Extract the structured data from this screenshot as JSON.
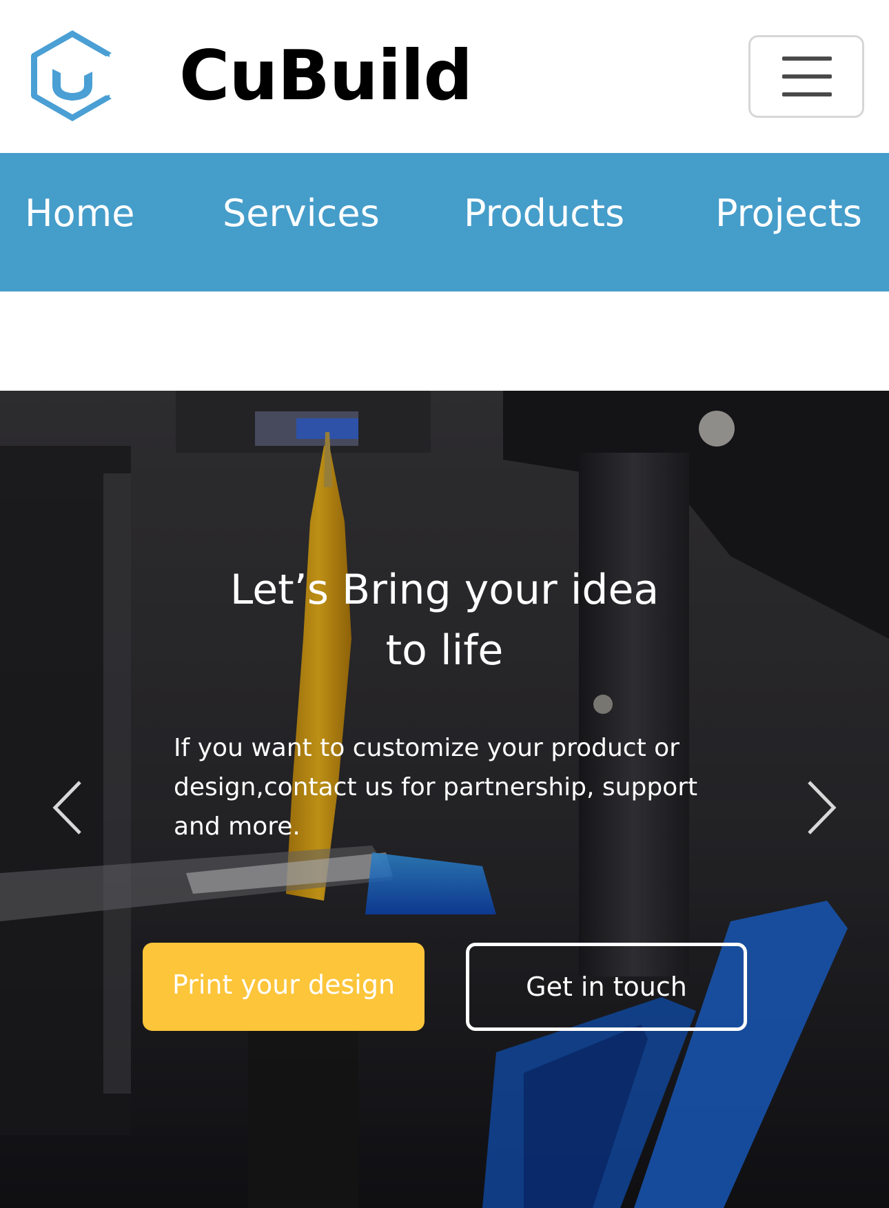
{
  "header": {
    "brand": "CuBuild",
    "logo_icon": "hexagon-cube-logo-icon",
    "menu_icon": "hamburger-menu-icon"
  },
  "nav": {
    "items": [
      {
        "label": "Home"
      },
      {
        "label": "Services"
      },
      {
        "label": "Products"
      },
      {
        "label": "Projects"
      }
    ]
  },
  "hero": {
    "title_line1": "Let’s Bring your idea",
    "title_line2": "to life",
    "text": "If you want to customize your product or design,contact us for partnership, support and more.",
    "primary_button": "Print your design",
    "secondary_button": "Get in touch",
    "prev_icon": "chevron-left-icon",
    "next_icon": "chevron-right-icon"
  },
  "colors": {
    "nav_background": "#459dca",
    "logo": "#4a9fd4",
    "primary_button": "#fcc53a",
    "text_on_dark": "#ffffff"
  }
}
